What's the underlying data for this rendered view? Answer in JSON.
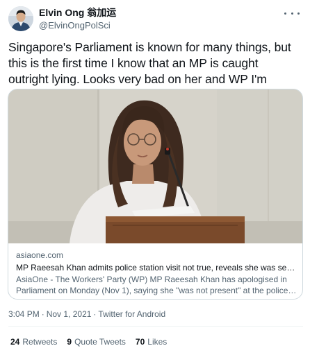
{
  "author": {
    "display_name": "Elvin Ong 翁加运",
    "handle": "@ElvinOngPolSci"
  },
  "tweet": {
    "text": "Singapore's Parliament is known for many things, but\nthis is the first time I know that an MP is caught\noutright lying. Looks very bad on her and WP I'm afraid."
  },
  "card": {
    "domain": "asiaone.com",
    "title": "MP Raeesah Khan admits police station visit not true, reveals she was sexually ...",
    "description_line1": "AsiaOne - The Workers' Party (WP) MP Raeesah Khan has apologised in",
    "description_line2": "Parliament on Monday (Nov 1), saying she \"was not present\" at the police ..."
  },
  "meta": {
    "time": "3:04 PM",
    "date": "Nov 1, 2021",
    "separator": "·",
    "source": "Twitter for Android"
  },
  "stats": {
    "retweets_count": "24",
    "retweets_label": "Retweets",
    "quotes_count": "9",
    "quotes_label": "Quote Tweets",
    "likes_count": "70",
    "likes_label": "Likes"
  },
  "icons": {
    "more": "more-horizontal-icon"
  },
  "colors": {
    "text": "#0f1419",
    "secondary": "#536471",
    "border": "#cfd9de"
  }
}
